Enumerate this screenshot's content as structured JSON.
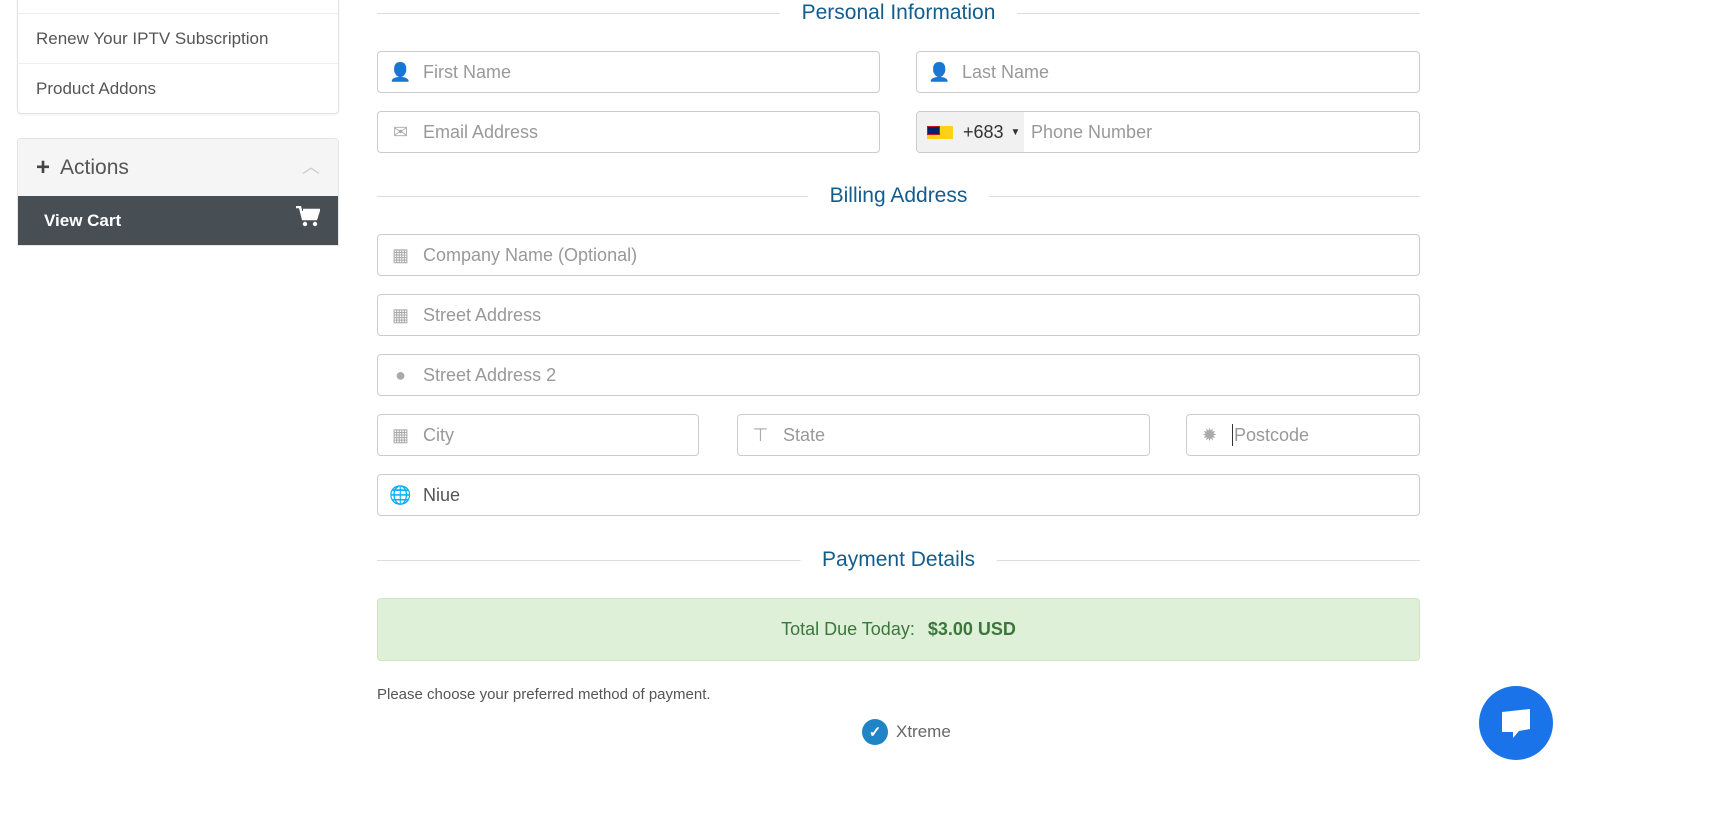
{
  "sidebar": {
    "items": [
      {
        "label": ""
      },
      {
        "label": "Renew Your IPTV Subscription"
      },
      {
        "label": "Product Addons"
      }
    ],
    "actions": {
      "title": "Actions",
      "view_cart": "View Cart"
    }
  },
  "sections": {
    "personal": "Personal Information",
    "billing": "Billing Address",
    "payment": "Payment Details"
  },
  "fields": {
    "first_name": {
      "placeholder": "First Name",
      "icon": "user-icon"
    },
    "last_name": {
      "placeholder": "Last Name",
      "icon": "user-icon"
    },
    "email": {
      "placeholder": "Email Address",
      "icon": "envelope-icon"
    },
    "phone": {
      "placeholder": "Phone Number",
      "country_code": "+683",
      "flag": "niue-flag"
    },
    "company": {
      "placeholder": "Company Name (Optional)",
      "icon": "building-icon"
    },
    "street": {
      "placeholder": "Street Address",
      "icon": "building-icon"
    },
    "street2": {
      "placeholder": "Street Address 2",
      "icon": "map-marker-icon"
    },
    "city": {
      "placeholder": "City",
      "icon": "building-icon"
    },
    "state": {
      "placeholder": "State",
      "icon": "signpost-icon"
    },
    "postcode": {
      "placeholder": "Postcode",
      "icon": "certificate-icon"
    },
    "country": {
      "value": "Niue",
      "icon": "globe-icon"
    }
  },
  "payment": {
    "total_label": "Total Due Today:",
    "total_value": "$3.00 USD",
    "choose_text": "Please choose your preferred method of payment.",
    "method": "Xtreme"
  },
  "colors": {
    "accent": "#135d8d",
    "success_bg": "#dff0d8",
    "chat": "#1a73e8",
    "dark": "#474f55"
  }
}
